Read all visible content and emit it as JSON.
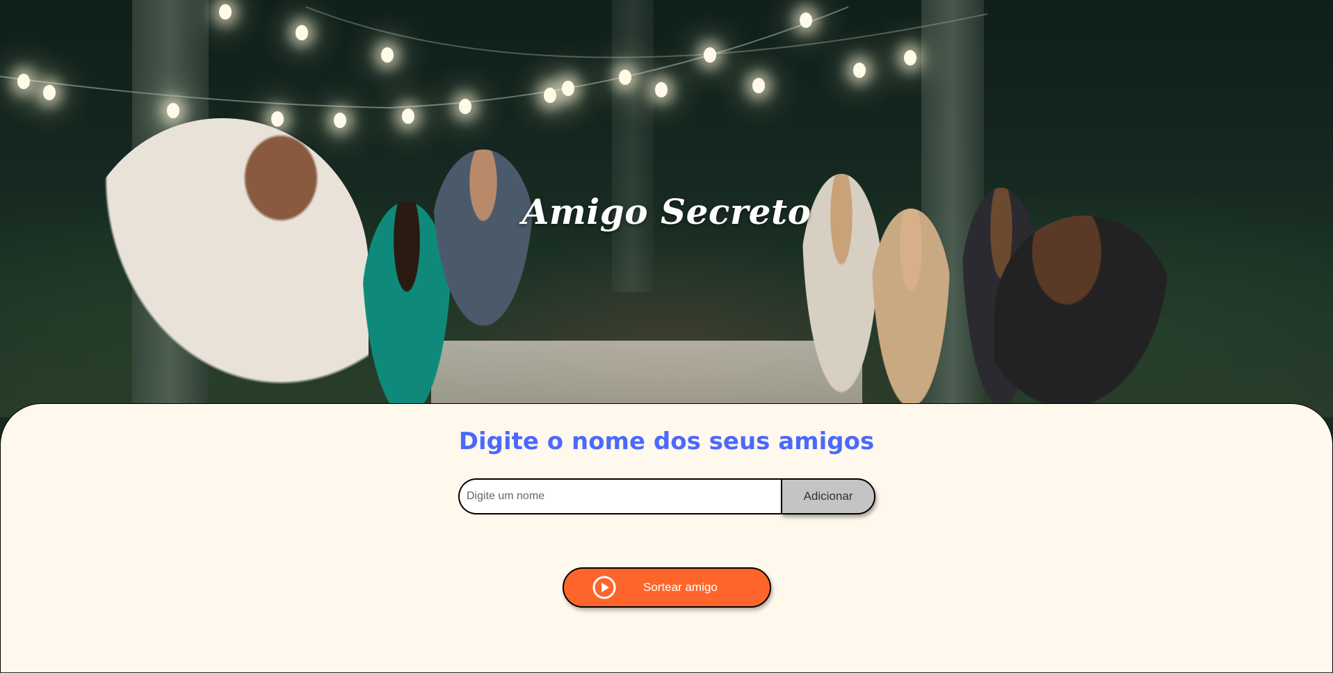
{
  "hero": {
    "title": "Amigo Secreto",
    "image_description_icon": "party-photo"
  },
  "form": {
    "heading": "Digite o nome dos seus amigos",
    "name_input": {
      "placeholder": "Digite um nome",
      "value": ""
    },
    "add_button_label": "Adicionar",
    "draw_button_label": "Sortear amigo",
    "draw_button_icon": "play-circle-icon"
  },
  "colors": {
    "heading": "#4b69fd",
    "panel_background": "#fff8ec",
    "draw_button": "#fe652b",
    "add_button": "#c4c4c4"
  }
}
